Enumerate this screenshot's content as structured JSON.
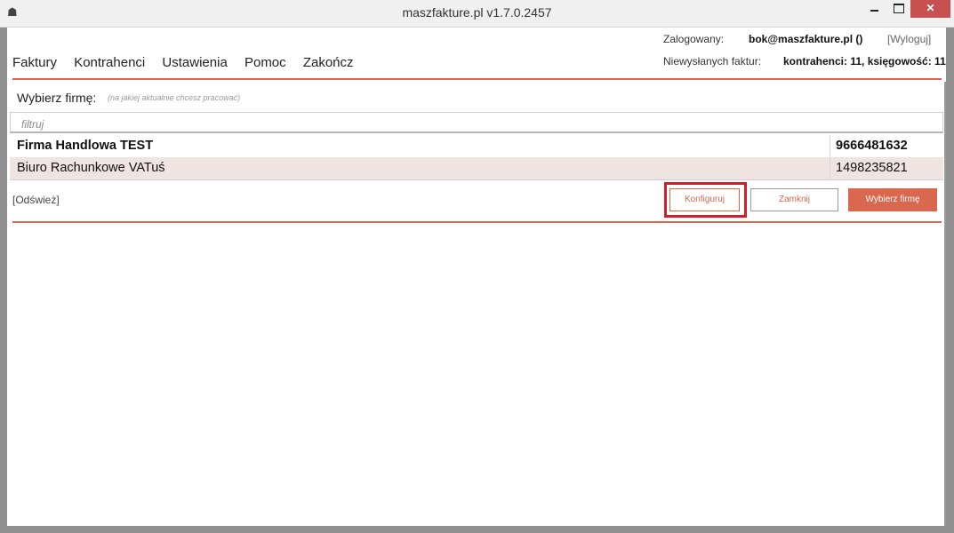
{
  "window": {
    "title": "maszfakture.pl  v1.7.0.2457",
    "app_icon": "app-logo-icon",
    "minimize_icon": "minimize-icon",
    "maximize_icon": "maximize-icon",
    "close_icon": "close-icon",
    "close_glyph": "✕"
  },
  "menu": {
    "items": [
      {
        "label": "Faktury"
      },
      {
        "label": "Kontrahenci"
      },
      {
        "label": "Ustawienia"
      },
      {
        "label": "Pomoc"
      },
      {
        "label": "Zakończ"
      }
    ]
  },
  "status": {
    "login_label": "Zalogowany:",
    "login_value": "bok@maszfakture.pl ()",
    "logout_link": "[Wyloguj]",
    "unsent_label": "Niewysłanych faktur:",
    "unsent_value": "kontrahenci: 11, księgowość: 11"
  },
  "chooser": {
    "label": "Wybierz firmę:",
    "hint": "(na jakiej aktualnie chcesz pracować)",
    "filter_placeholder": "filtruj",
    "companies": [
      {
        "name": "Firma Handlowa TEST",
        "nip": "9666481632"
      },
      {
        "name": "Biuro Rachunkowe VATuś",
        "nip": "1498235821"
      }
    ],
    "refresh_link": "[Odśwież]",
    "configure_button": "Konfiguruj",
    "close_button": "Zamknij",
    "select_button": "Wybierz firmę"
  },
  "colors": {
    "accent": "#d9684e",
    "highlight": "#d41d2a",
    "alt_row": "#efe4e2"
  }
}
